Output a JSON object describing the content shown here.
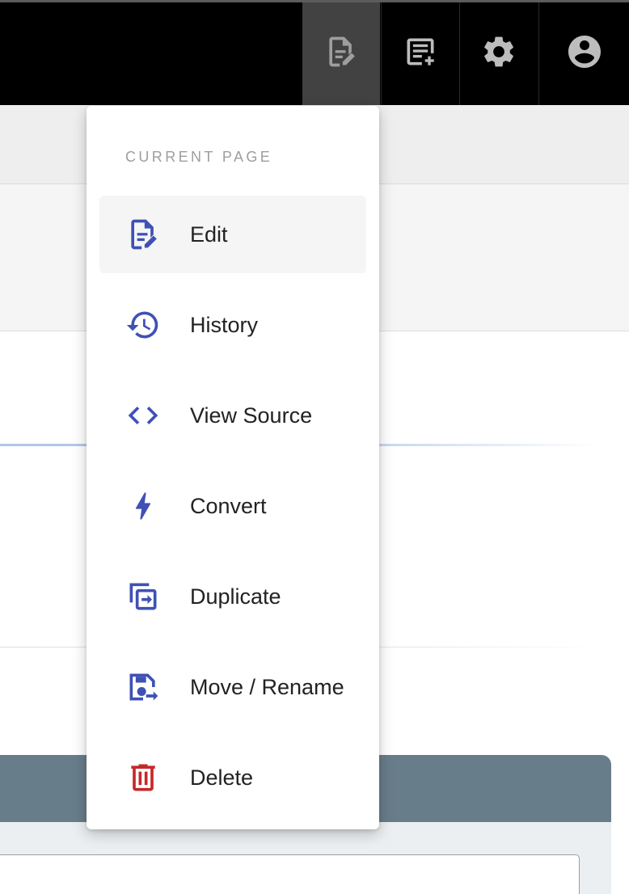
{
  "topbar": {
    "buttons": [
      {
        "icon": "page-edit-icon"
      },
      {
        "icon": "new-page-icon"
      },
      {
        "icon": "gear-icon"
      },
      {
        "icon": "account-circle-icon"
      }
    ]
  },
  "menu": {
    "header": "CURRENT PAGE",
    "items": [
      {
        "label": "Edit",
        "icon": "page-edit-icon",
        "active": true
      },
      {
        "label": "History",
        "icon": "history-icon"
      },
      {
        "label": "View Source",
        "icon": "code-brackets-icon"
      },
      {
        "label": "Convert",
        "icon": "lightning-bolt-icon"
      },
      {
        "label": "Duplicate",
        "icon": "duplicate-icon"
      },
      {
        "label": "Move / Rename",
        "icon": "move-rename-icon"
      },
      {
        "label": "Delete",
        "icon": "trash-icon"
      }
    ]
  },
  "colors": {
    "accent_icon": "#3f51b5",
    "delete_icon": "#c62828",
    "topbar_bg": "#000000",
    "topbar_active_bg": "#424242",
    "card_header_bg": "#687d8a"
  }
}
